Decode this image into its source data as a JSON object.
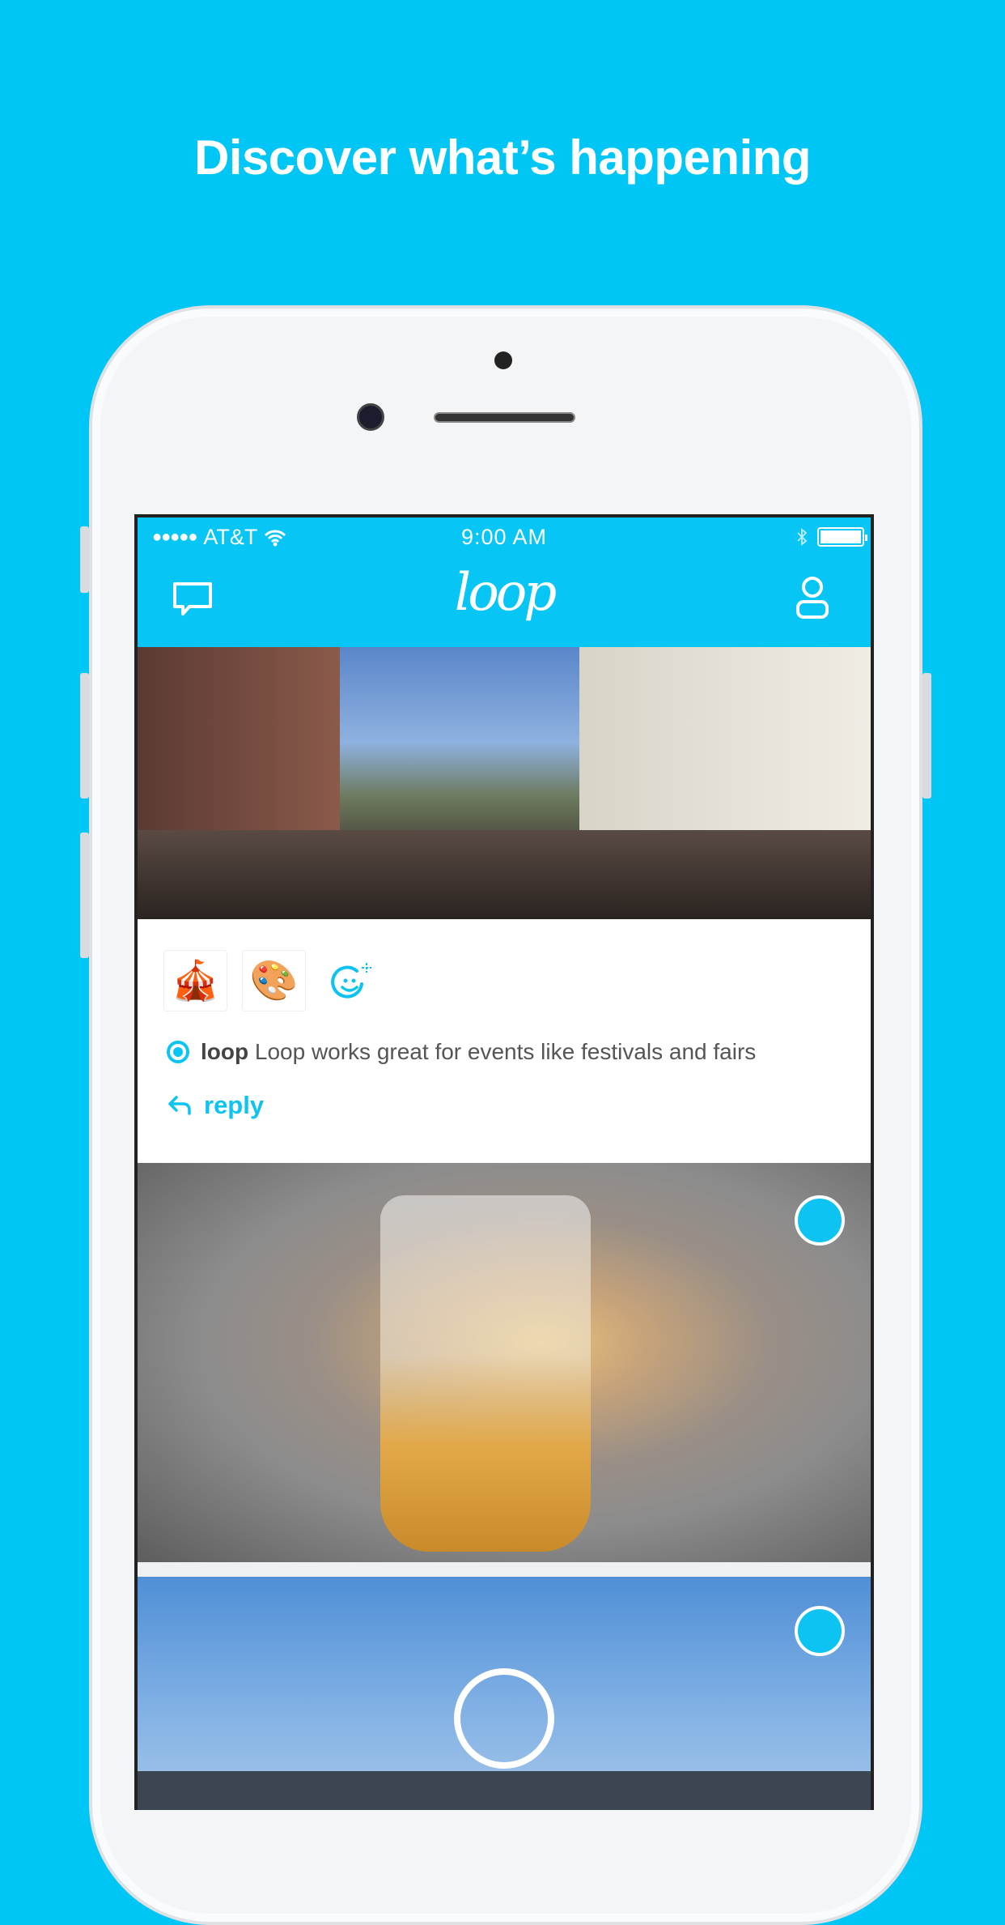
{
  "headline": "Discover what’s happening",
  "status_bar": {
    "signal": "●●●●●",
    "carrier": "AT&T",
    "time": "9:00 AM"
  },
  "nav": {
    "logo": "loop"
  },
  "post": {
    "emojis": [
      "🎪",
      "🎨"
    ],
    "author": "loop",
    "text": "Loop works great for events like festivals and fairs",
    "reply_label": "reply"
  },
  "colors": {
    "background": "#00c6f6",
    "accent": "#0cc3f2"
  }
}
